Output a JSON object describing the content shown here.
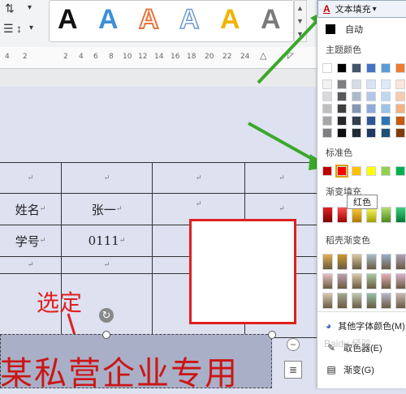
{
  "toolbar": {
    "style_glyph": "A",
    "style_colors": [
      "#111111",
      "#3f8fd8",
      "#e8743b",
      "#8fb8e0",
      "#f2b400",
      "#7a7a7a"
    ],
    "text_fill_label": "文本填充",
    "text_fill_caret": "▾",
    "small_caret": "▾"
  },
  "ruler": {
    "numbers": [
      "4",
      "2",
      "2",
      "4",
      "6",
      "8",
      "10",
      "12",
      "14",
      "16",
      "18",
      "20",
      "22",
      "24"
    ]
  },
  "table": {
    "para_mark": "↵",
    "name_label": "姓名",
    "name_value": "张一",
    "id_label": "学号",
    "id_value": "0111"
  },
  "annotation": {
    "text": "选定",
    "color": "#e02020"
  },
  "wordart": {
    "text": "某私营企业专用",
    "color": "#cc1515"
  },
  "color_menu": {
    "auto_label": "自动",
    "theme_colors_label": "主题颜色",
    "standard_colors_label": "标准色",
    "gradient_fill_label": "渐变填充",
    "gradient_label_short": "渐变填充",
    "shell_gradient_label": "稻壳渐变色",
    "tooltip": "红色",
    "more_colors_label": "其他字体颜色(M)...",
    "eyedropper_label": "取色器(E)",
    "gradient_menu_label": "渐变(G)",
    "theme_top_row": [
      "#ffffff",
      "#000000",
      "#44546a",
      "#4472c4",
      "#5b9bd5",
      "#ed7d31"
    ],
    "standard_colors": [
      "#c00000",
      "#ff0000",
      "#ffc000",
      "#ffff00",
      "#92d050",
      "#00b050"
    ],
    "watermark": "Baidu 经验"
  }
}
